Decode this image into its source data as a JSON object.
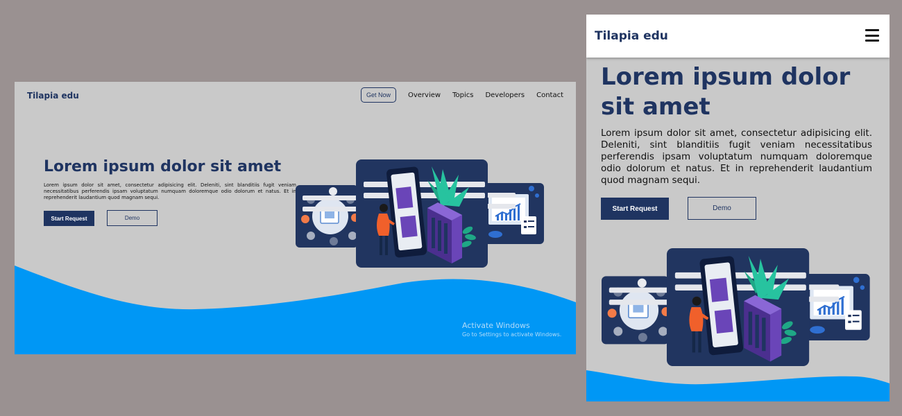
{
  "desktop": {
    "brand": "Tilapia edu",
    "nav": {
      "cta_label": "Get Now",
      "links": [
        "Overview",
        "Topics",
        "Developers",
        "Contact"
      ]
    },
    "hero": {
      "title": "Lorem ipsum dolor sit amet",
      "paragraph": "Lorem ipsum dolor sit amet, consectetur adipisicing elit. Deleniti, sint blanditiis fugit veniam necessitatibus perferendis ipsam voluptatum numquam doloremque odio dolorum et natus. Et in reprehenderit laudantium quod magnam sequi.",
      "primary_button": "Start Request",
      "secondary_button": "Demo"
    },
    "watermark": {
      "line1": "Activate Windows",
      "line2": "Go to Settings to activate Windows."
    }
  },
  "mobile": {
    "brand": "Tilapia edu",
    "menu_icon": "hamburger-icon",
    "hero": {
      "title": "Lorem ipsum dolor sit amet",
      "paragraph": "Lorem ipsum dolor sit amet, consectetur adipisicing elit. Deleniti, sint blanditiis fugit veniam necessitatibus perferendis ipsam voluptatum numquam doloremque odio dolorum et natus. Et in reprehenderit laudantium quod magnam sequi.",
      "primary_button": "Start Request",
      "secondary_button": "Demo"
    }
  },
  "colors": {
    "outer_background": "#9a9191",
    "page_background": "#c9c9c9",
    "brand_navy": "#1f3461",
    "wave_blue": "#0097f5",
    "mobile_header": "#ffffff"
  }
}
